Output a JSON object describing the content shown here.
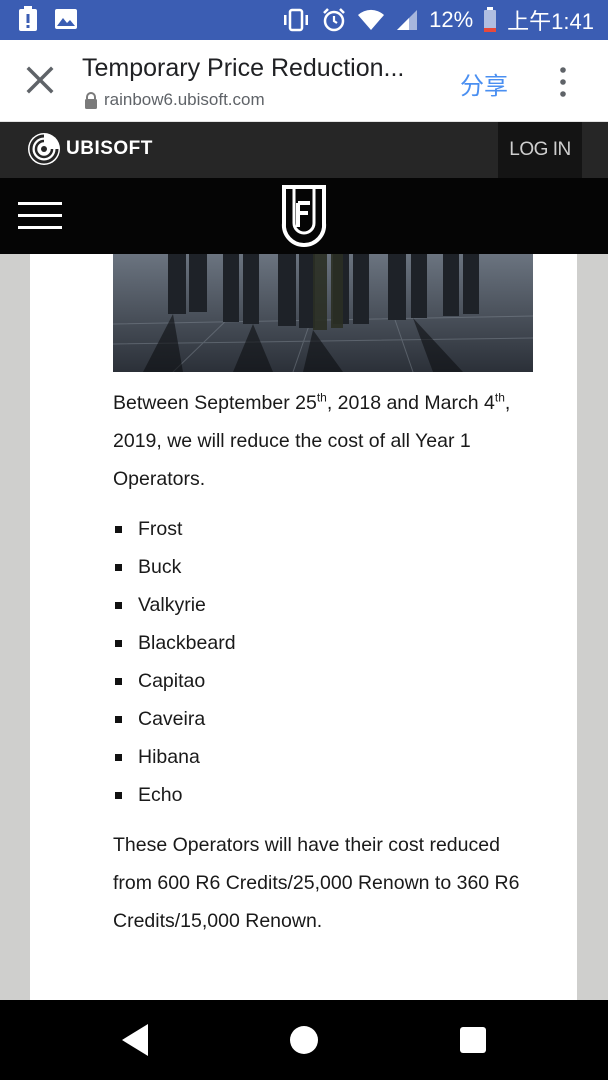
{
  "status_bar": {
    "battery_percent": "12%",
    "time": "上午1:41"
  },
  "custom_tab": {
    "title": "Temporary Price Reduction...",
    "url": "rainbow6.ubisoft.com",
    "share_label": "分享"
  },
  "ubisoft_bar": {
    "logo_text": "UBISOFT",
    "login_label": "LOG IN"
  },
  "article": {
    "intro": {
      "part1": "Between September 25",
      "sup1": "th",
      "part2": ", 2018 and March 4",
      "sup2": "th",
      "part3": ", 2019, we will reduce the cost of all Year 1 Operators."
    },
    "operators": [
      "Frost",
      "Buck",
      "Valkyrie",
      "Blackbeard",
      "Capitao",
      "Caveira",
      "Hibana",
      "Echo"
    ],
    "closing": "These Operators will have their cost reduced from 600 R6 Credits/25,000 Renown to 360 R6 Credits/15,000 Renown."
  },
  "colors": {
    "status_bar_bg": "#3b5db3",
    "share_blue": "#4a8ff1",
    "ubisoft_bar_bg": "#262626",
    "r6_nav_bg": "#050505"
  }
}
